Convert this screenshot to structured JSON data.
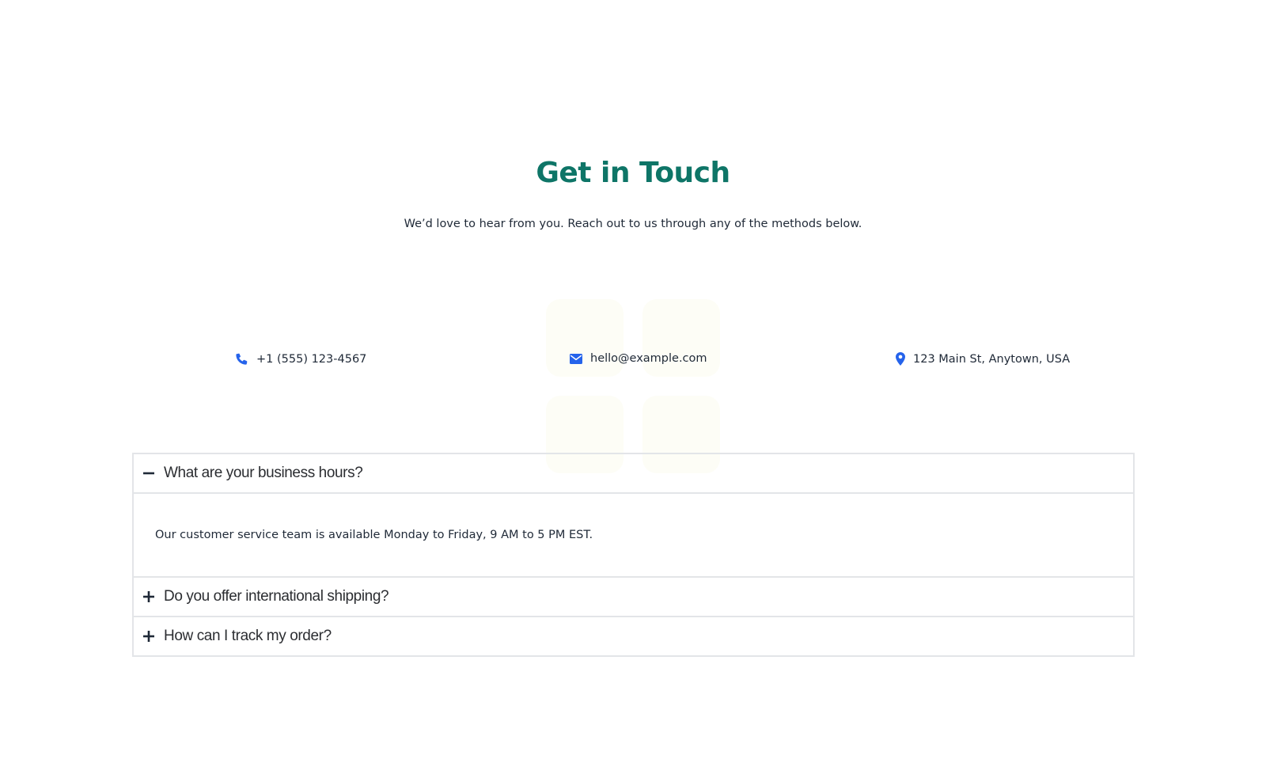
{
  "header": {
    "title": "Get in Touch",
    "subtitle": "We’d love to hear from you. Reach out to us through any of the methods below."
  },
  "contact": {
    "phone": {
      "icon": "phone-icon",
      "label": "+1 (555) 123-4567"
    },
    "email": {
      "icon": "envelope-icon",
      "label": "hello@example.com"
    },
    "address": {
      "icon": "map-pin-icon",
      "label": "123 Main St, Anytown, USA"
    }
  },
  "faq": {
    "items": [
      {
        "question": "What are your business hours?",
        "expanded": true,
        "toggle_icon": "minus-icon",
        "answer": "Our customer service team is available Monday to Friday, 9 AM to 5 PM EST."
      },
      {
        "question": "Do you offer international shipping?",
        "expanded": false,
        "toggle_icon": "plus-icon"
      },
      {
        "question": "How can I track my order?",
        "expanded": false,
        "toggle_icon": "plus-icon"
      }
    ]
  },
  "colors": {
    "heading": "#0e7567",
    "icon_accent": "#2563eb",
    "border": "#e3e5e8",
    "text": "#1f2937"
  }
}
